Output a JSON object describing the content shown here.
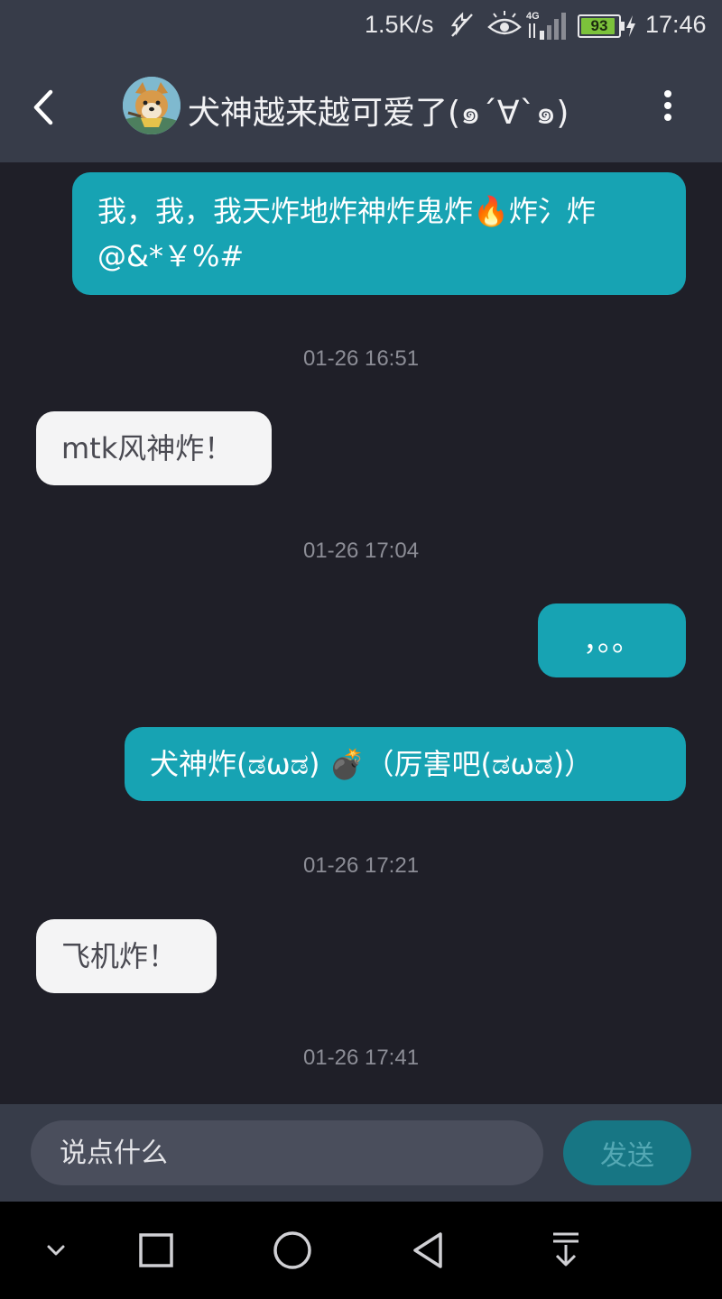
{
  "status_bar": {
    "speed": "1.5K/s",
    "network": "4G",
    "battery": "93",
    "battery_level": 0.93,
    "time": "17:46",
    "icons": [
      "mute-icon",
      "eye-icon",
      "signal-icon",
      "battery-icon",
      "charging-icon"
    ]
  },
  "header": {
    "title": "犬神越来越可爱了(๑´∀`๑)",
    "back_icon": "chevron-left-icon",
    "menu_icon": "more-vertical-icon"
  },
  "messages": [
    {
      "side": "sent",
      "line1": "我，我，我天炸地炸神炸鬼炸🔥炸氵炸",
      "line2": "@&*￥%#"
    },
    {
      "timestamp": "01-26 16:51"
    },
    {
      "side": "recv",
      "text": "mtk风神炸！"
    },
    {
      "timestamp": "01-26 17:04"
    },
    {
      "side": "sent",
      "text": "，。。"
    },
    {
      "side": "sent",
      "text": "犬神炸(ಡωಡ) 💣（厉害吧(ಡωಡ)）"
    },
    {
      "timestamp": "01-26 17:21"
    },
    {
      "side": "recv",
      "text": "飞机炸！"
    },
    {
      "timestamp": "01-26 17:41"
    }
  ],
  "input": {
    "placeholder": "说点什么",
    "value": "",
    "send_label": "发送"
  },
  "nav_bar": {
    "icons": [
      "chevron-down-icon",
      "square-icon",
      "circle-home-icon",
      "triangle-back-icon",
      "download-icon"
    ]
  },
  "colors": {
    "background": "#1f1f28",
    "bar": "#373c49",
    "sent_bubble": "#17a3b3",
    "recv_bubble": "#f4f4f5",
    "send_button": "#177684"
  }
}
